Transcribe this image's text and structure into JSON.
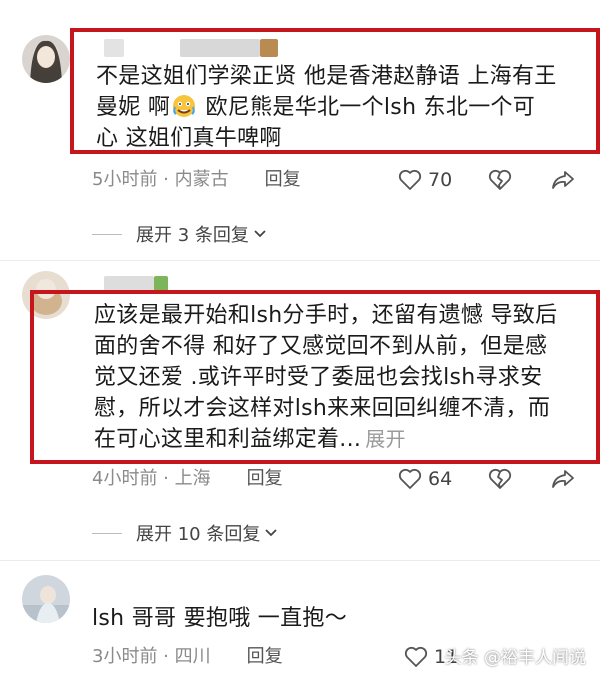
{
  "comments": [
    {
      "content_line1": "不是这姐们学梁正贤 他是香港赵静语 上海有王",
      "content_line2_a": "曼妮 啊",
      "content_line2_b": " 欧尼熊是华北一个lsh 东北一个可",
      "content_line3": "心 这姐们真牛啤啊",
      "time_location": "5小时前 · 内蒙古",
      "reply_label": "回复",
      "likes": "70",
      "expand_label": "展开 3 条回复"
    },
    {
      "content_line1": "应该是最开始和lsh分手时，还留有遗憾 导致后",
      "content_line2": "面的舍不得 和好了又感觉回不到从前，但是感",
      "content_line3": "觉又还爱 .或许平时受了委屈也会找lsh寻求安",
      "content_line4": "慰，所以才会这样对lsh来来回回纠缠不清，而",
      "content_line5": "在可心这里和利益绑定着...",
      "more_label": "展开",
      "time_location": "4小时前 · 上海",
      "reply_label": "回复",
      "likes": "64",
      "expand_label": "展开 10 条回复"
    },
    {
      "content_line1": "lsh 哥哥 要抱哦 一直抱～",
      "time_location": "3小时前 · 四川",
      "reply_label": "回复",
      "likes": "11"
    }
  ],
  "watermark": "头条 @裕丰人间说",
  "colors": {
    "highlight": "#c4161c",
    "meta": "#8a8a8a"
  }
}
